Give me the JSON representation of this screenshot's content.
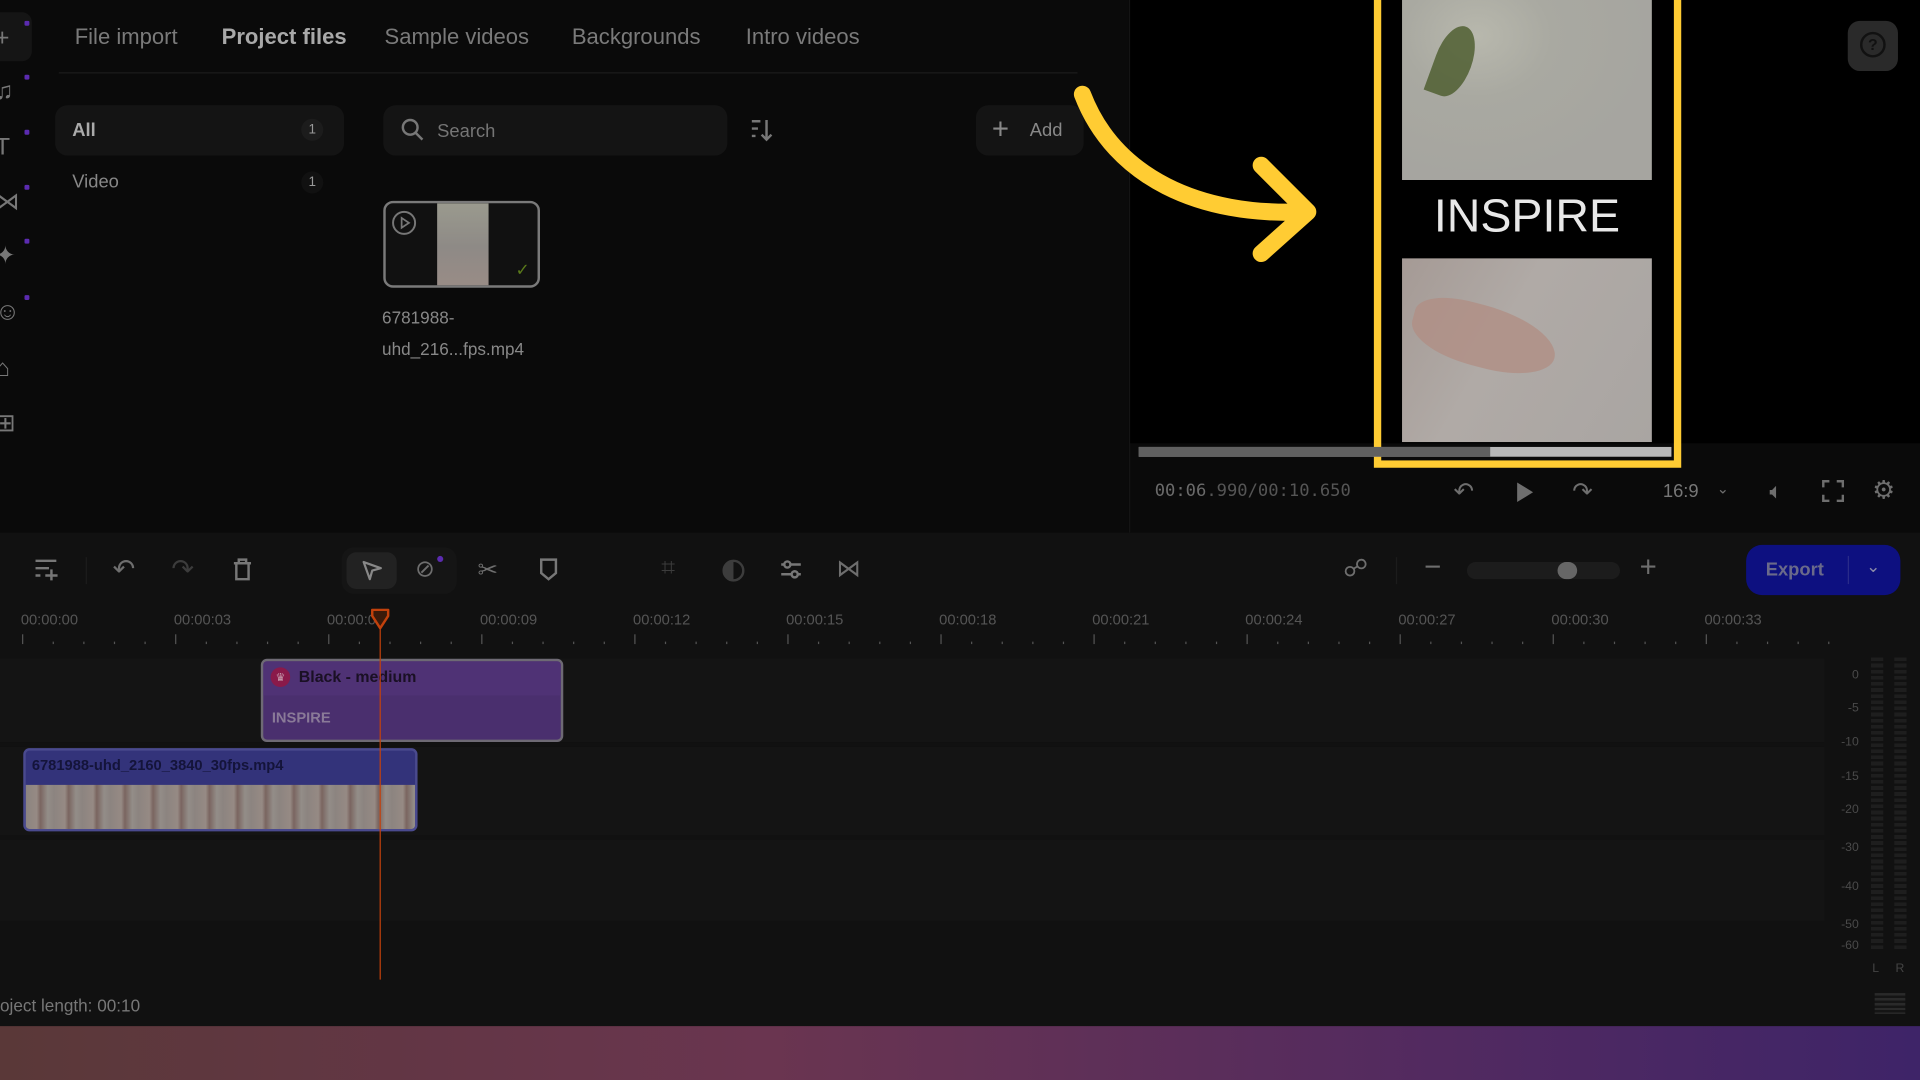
{
  "tabs": [
    {
      "label": "File import"
    },
    {
      "label": "Project files",
      "active": true
    },
    {
      "label": "Sample videos"
    },
    {
      "label": "Backgrounds"
    },
    {
      "label": "Intro videos"
    }
  ],
  "filters": [
    {
      "label": "All",
      "count": "1"
    },
    {
      "label": "Video",
      "count": "1"
    }
  ],
  "search": {
    "placeholder": "Search"
  },
  "add_label": "Add",
  "media": {
    "filename_line1": "6781988-",
    "filename_line2": "uhd_216...fps.mp4"
  },
  "preview": {
    "overlay_text": "INSPIRE",
    "time_current": "00:06",
    "time_rest": ".990/00:10.650",
    "aspect": "16:9",
    "progress_fraction": 0.66
  },
  "toolbar": {
    "export_label": "Export",
    "zoom_fraction": 0.68
  },
  "ruler": [
    "00:00:00",
    "00:00:03",
    "00:00:06",
    "00:00:09",
    "00:00:12",
    "00:00:15",
    "00:00:18",
    "00:00:21",
    "00:00:24",
    "00:00:27",
    "00:00:30",
    "00:00:33"
  ],
  "tracks": {
    "text_clip": {
      "title": "Black - medium",
      "text": "INSPIRE"
    },
    "video_clip": {
      "title": "6781988-uhd_2160_3840_30fps.mp4"
    }
  },
  "meter": {
    "labels": [
      "0",
      "-5",
      "-10",
      "-15",
      "-20",
      "-30",
      "-40",
      "-50",
      "-60"
    ],
    "left": "L",
    "right": "R"
  },
  "project_length": "oject length: 00:10",
  "colors": {
    "accent_yellow": "#ffcc33",
    "export": "#0d1080",
    "playhead": "#c2410c",
    "text_clip": "#4a2f6e",
    "video_clip": "#33337a"
  }
}
